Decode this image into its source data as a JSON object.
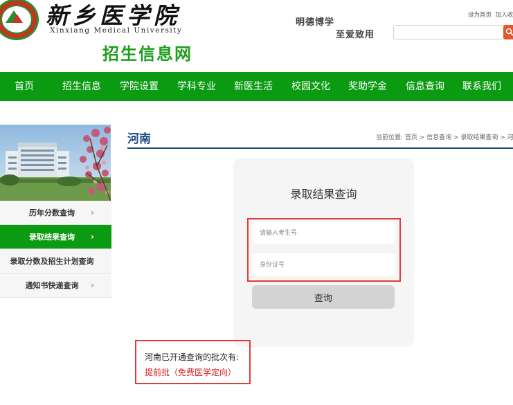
{
  "header": {
    "university_cn": "新乡医学院",
    "university_en": "Xinxiang Medical University",
    "site_name": "招生信息网",
    "motto_line1": "明德博学",
    "motto_line2": "至爱致用",
    "top_links": [
      "设为首页",
      "加入收"
    ],
    "search": {
      "placeholder": "",
      "value": ""
    },
    "logo_icon": "university-seal",
    "search_icon": "magnifier"
  },
  "nav": {
    "items": [
      "首页",
      "招生信息",
      "学院设置",
      "学科专业",
      "新医生活",
      "校园文化",
      "奖助学金",
      "信息查询",
      "联系我们"
    ]
  },
  "sidebar": {
    "items": [
      {
        "label": "历年分数查询",
        "active": false
      },
      {
        "label": "录取结果查询",
        "active": true
      },
      {
        "label": "录取分数及招生计划查询",
        "active": false
      },
      {
        "label": "通知书快递查询",
        "active": false
      }
    ],
    "arrow_glyph": "›"
  },
  "main": {
    "section_title": "河南",
    "breadcrumb": "当前位置: 首页 > 信息查询 > 录取结果查询 > 河"
  },
  "query": {
    "title": "录取结果查询",
    "exam_no_placeholder": "请输入考生号",
    "id_placeholder": "身份证号",
    "submit_label": "查询"
  },
  "batches": {
    "title": "河南已开通查询的批次有:",
    "items": [
      "提前批（免费医学定向）"
    ]
  },
  "colors": {
    "nav_green": "#0b9b12",
    "site_name_green": "#1e9e1e",
    "title_blue": "#1a4a8a",
    "highlight_red": "#e23b3b",
    "batch_red": "#d32020"
  }
}
